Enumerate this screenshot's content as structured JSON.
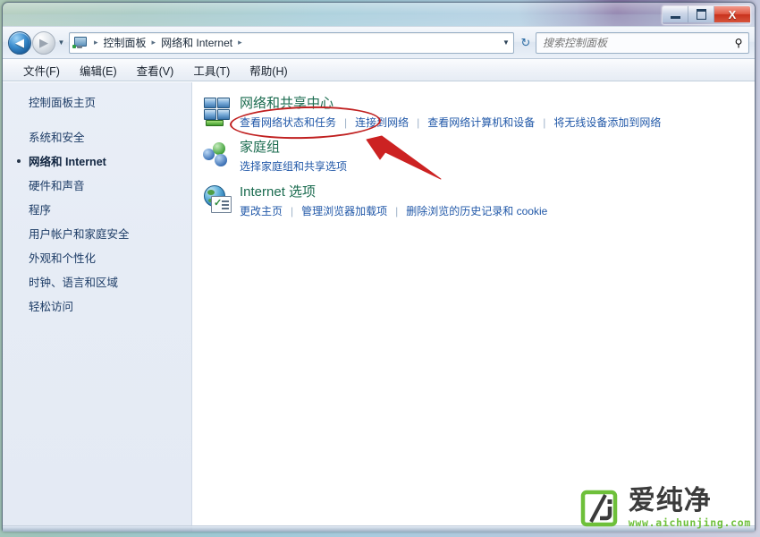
{
  "window": {
    "caption_buttons": [
      {
        "name": "minimize",
        "label": "–"
      },
      {
        "name": "maximize",
        "label": "□"
      },
      {
        "name": "close",
        "label": "X"
      }
    ]
  },
  "navbar": {
    "back_glyph": "◀",
    "forward_glyph": "▶",
    "recent_glyph": "▼",
    "breadcrumb_dd_glyph": "▼",
    "refresh_glyph": "↻",
    "breadcrumbs": [
      {
        "label": "控制面板"
      },
      {
        "label": "网络和 Internet"
      }
    ],
    "separator": "▸",
    "search": {
      "value": "",
      "placeholder": "搜索控制面板",
      "icon_glyph": "⚲"
    }
  },
  "menubar": {
    "items": [
      {
        "label": "文件(F)"
      },
      {
        "label": "编辑(E)"
      },
      {
        "label": "查看(V)"
      },
      {
        "label": "工具(T)"
      },
      {
        "label": "帮助(H)"
      }
    ]
  },
  "sidebar": {
    "home_label": "控制面板主页",
    "items": [
      {
        "label": "系统和安全",
        "current": false
      },
      {
        "label": "网络和 Internet",
        "current": true
      },
      {
        "label": "硬件和声音",
        "current": false
      },
      {
        "label": "程序",
        "current": false
      },
      {
        "label": "用户帐户和家庭安全",
        "current": false
      },
      {
        "label": "外观和个性化",
        "current": false
      },
      {
        "label": "时钟、语言和区域",
        "current": false
      },
      {
        "label": "轻松访问",
        "current": false
      }
    ]
  },
  "content": {
    "categories": [
      {
        "icon": "network-sharing-center-icon",
        "title": "网络和共享中心",
        "links": [
          "查看网络状态和任务",
          "连接到网络",
          "查看网络计算机和设备",
          "将无线设备添加到网络"
        ]
      },
      {
        "icon": "homegroup-icon",
        "title": "家庭组",
        "links": [
          "选择家庭组和共享选项"
        ]
      },
      {
        "icon": "internet-options-icon",
        "title": "Internet 选项",
        "links": [
          "更改主页",
          "管理浏览器加载项",
          "删除浏览的历史记录和 cookie"
        ]
      }
    ],
    "link_separator": "|"
  },
  "annotations": {
    "ellipse_color": "#c02020",
    "arrow_color": "#cc2222",
    "ellipse_target": "查看网络状态和任务"
  },
  "watermark": {
    "name": "爱纯净",
    "url": "www.aichunjing.com",
    "logo_color": "#6ec03a",
    "text_color": "#3b3b3b"
  },
  "colors": {
    "category_title": "#1a6b4f",
    "link": "#2158a8",
    "sidebar_bg": "#e6ecf5",
    "content_bg": "#ffffff"
  }
}
